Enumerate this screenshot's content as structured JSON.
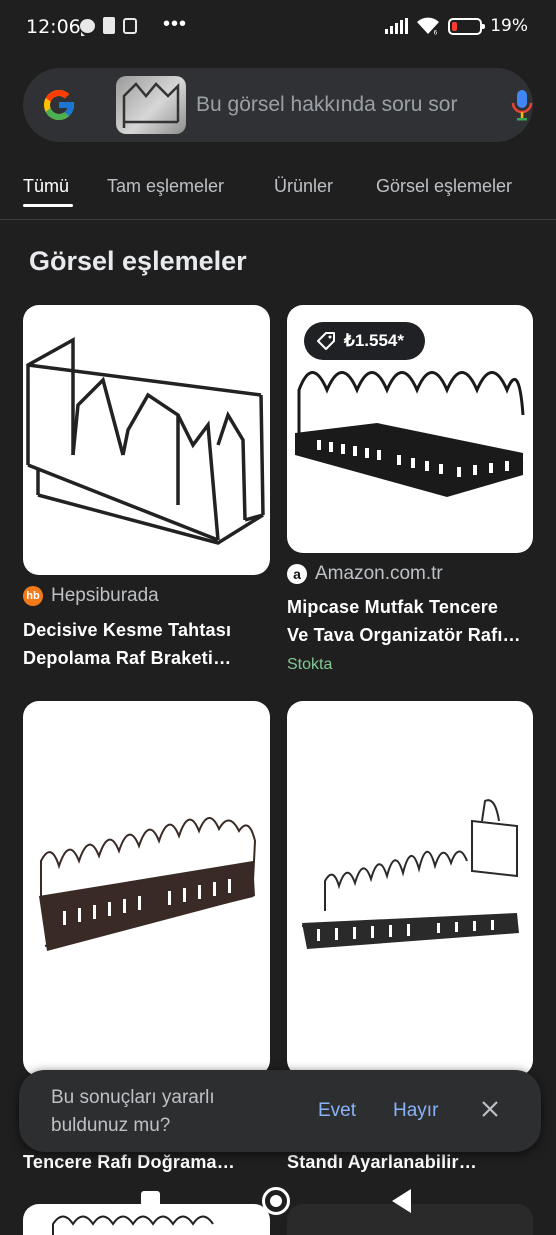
{
  "status_bar": {
    "time": "12:06",
    "more": "•••",
    "battery_percent": "19%"
  },
  "search": {
    "placeholder": "Bu görsel hakkında soru sor"
  },
  "tabs": [
    {
      "label": "Tümü",
      "active": true
    },
    {
      "label": "Tam eşlemeler",
      "active": false
    },
    {
      "label": "Ürünler",
      "active": false
    },
    {
      "label": "Görsel eşlemeler",
      "active": false
    }
  ],
  "section_title": "Görsel eşlemeler",
  "results": [
    {
      "source": "Hepsiburada",
      "source_icon_text": "hb",
      "title_line1": "Decisive Kesme Tahtası",
      "title_line2": "Depolama Raf Braketi…"
    },
    {
      "price": "₺1.554*",
      "source": "Amazon.com.tr",
      "source_icon_text": "a",
      "title_line1": "Mipcase Mutfak Tencere",
      "title_line2": "Ve Tava Organizatör Rafı…",
      "stock": "Stokta"
    },
    {
      "title_line2": "Tencere Rafı Doğrama…"
    },
    {
      "title_line2": "Standı Ayarlanabilir…"
    }
  ],
  "feedback": {
    "question": "Bu sonuçları yararlı buldunuz mu?",
    "yes": "Evet",
    "no": "Hayır"
  },
  "colors": {
    "background": "#1f1f1f",
    "link": "#8ab4f8",
    "stock": "#81c995",
    "battery_low": "#ff3b30"
  }
}
